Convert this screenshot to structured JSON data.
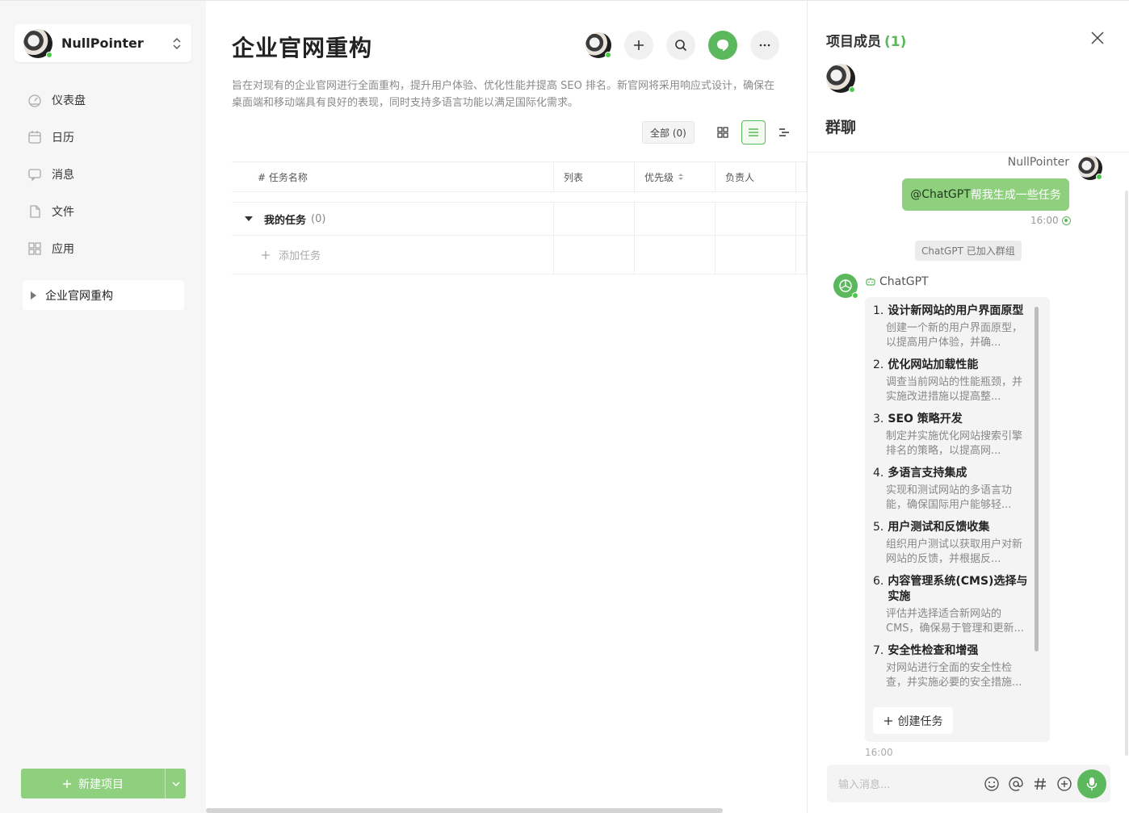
{
  "user": {
    "name": "NullPointer"
  },
  "nav": [
    {
      "label": "仪表盘",
      "icon": "dashboard-icon"
    },
    {
      "label": "日历",
      "icon": "calendar-icon"
    },
    {
      "label": "消息",
      "icon": "message-icon"
    },
    {
      "label": "文件",
      "icon": "file-icon"
    },
    {
      "label": "应用",
      "icon": "apps-icon"
    }
  ],
  "project_item": "企业官网重构",
  "new_project": "新建项目",
  "project": {
    "title": "企业官网重构",
    "description": "旨在对现有的企业官网进行全面重构，提升用户体验、优化性能并提高 SEO 排名。新官网将采用响应式设计，确保在桌面端和移动端具有良好的表现，同时支持多语言功能以满足国际化需求。",
    "filter_chip": "全部 (0)"
  },
  "table": {
    "columns": [
      "# 任务名称",
      "列表",
      "优先级",
      "负责人"
    ],
    "group_name": "我的任务",
    "group_count": "(0)",
    "add_task": "添加任务"
  },
  "panel": {
    "members_title": "项目成员",
    "members_count": "(1)",
    "group_title": "群聊",
    "my_name": "NullPointer",
    "my_message_mention": "@ChatGPT",
    "my_message_text": " 帮我生成一些任务",
    "my_time": "16:00",
    "system_message": "ChatGPT 已加入群组",
    "bot_name": "ChatGPT",
    "tasks": [
      {
        "num": "1.",
        "title": "设计新网站的用户界面原型",
        "desc": "创建一个新的用户界面原型，以提高用户体验，并确..."
      },
      {
        "num": "2.",
        "title": "优化网站加载性能",
        "desc": "调查当前网站的性能瓶颈，并实施改进措施以提高整..."
      },
      {
        "num": "3.",
        "title": "SEO 策略开发",
        "desc": "制定并实施优化网站搜索引擎排名的策略，以提高网..."
      },
      {
        "num": "4.",
        "title": "多语言支持集成",
        "desc": "实现和测试网站的多语言功能，确保国际用户能够轻..."
      },
      {
        "num": "5.",
        "title": "用户测试和反馈收集",
        "desc": "组织用户测试以获取用户对新网站的反馈，并根据反..."
      },
      {
        "num": "6.",
        "title": "内容管理系统(CMS)选择与实施",
        "desc": "评估并选择适合新网站的 CMS，确保易于管理和更新..."
      },
      {
        "num": "7.",
        "title": "安全性检查和增强",
        "desc": "对网站进行全面的安全性检查，并实施必要的安全措施..."
      }
    ],
    "create_task": "创建任务",
    "bot_time": "16:00",
    "input_placeholder": "输入消息..."
  },
  "colors": {
    "accent": "#5cb85c",
    "accent_light": "#8fd07f"
  }
}
